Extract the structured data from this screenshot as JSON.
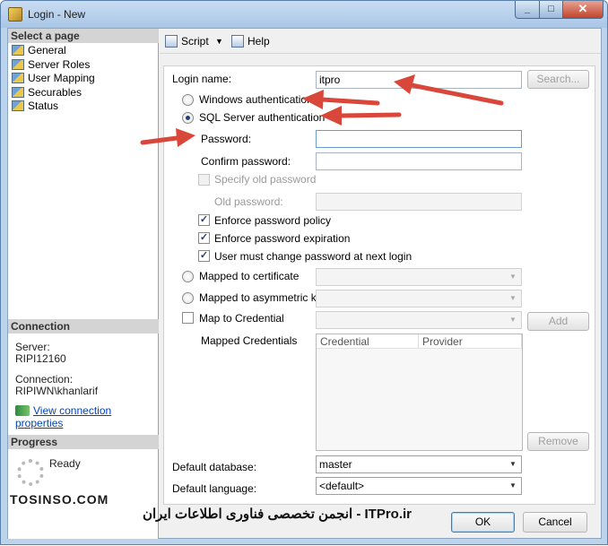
{
  "window": {
    "title": "Login - New",
    "controls": [
      "_",
      "□",
      "✕"
    ]
  },
  "left": {
    "select_page_header": "Select a page",
    "pages": [
      "General",
      "Server Roles",
      "User Mapping",
      "Securables",
      "Status"
    ],
    "connection_header": "Connection",
    "server_label": "Server:",
    "server_value": "RIPI12160",
    "connection_label": "Connection:",
    "connection_value": "RIPIWN\\khanlarif",
    "view_props_link": "View connection properties",
    "progress_header": "Progress",
    "progress_status": "Ready"
  },
  "toolbar": {
    "script_label": "Script",
    "script_arrow": "▼",
    "help_label": "Help"
  },
  "form": {
    "login_name_label": "Login name:",
    "login_name_value": "itpro",
    "search_button": "Search...",
    "windows_auth_label": "Windows authentication",
    "sql_auth_label": "SQL Server authentication",
    "password_label": "Password:",
    "confirm_password_label": "Confirm password:",
    "specify_old_label": "Specify old password",
    "old_password_label": "Old password:",
    "enforce_policy_label": "Enforce password policy",
    "enforce_expiration_label": "Enforce password expiration",
    "must_change_label": "User must change password at next login",
    "mapped_cert_label": "Mapped to certificate",
    "mapped_asym_label": "Mapped to asymmetric key",
    "map_cred_label": "Map to Credential",
    "add_button": "Add",
    "mapped_credentials_label": "Mapped Credentials",
    "cred_columns": [
      "Credential",
      "Provider"
    ],
    "remove_button": "Remove",
    "default_db_label": "Default database:",
    "default_db_value": "master",
    "default_lang_label": "Default language:",
    "default_lang_value": "<default>",
    "check_mark": "✓"
  },
  "footer": {
    "ok_button": "OK",
    "cancel_button": "Cancel"
  },
  "watermark": {
    "left_text": "TOSINSO.COM",
    "right_text": "ITPro.ir - انجمن تخصصی فناوری اطلاعات ایران"
  },
  "colors": {
    "arrow": "#d9473b",
    "accent": "#0645ad",
    "window_frame": "#bcd3ec"
  }
}
